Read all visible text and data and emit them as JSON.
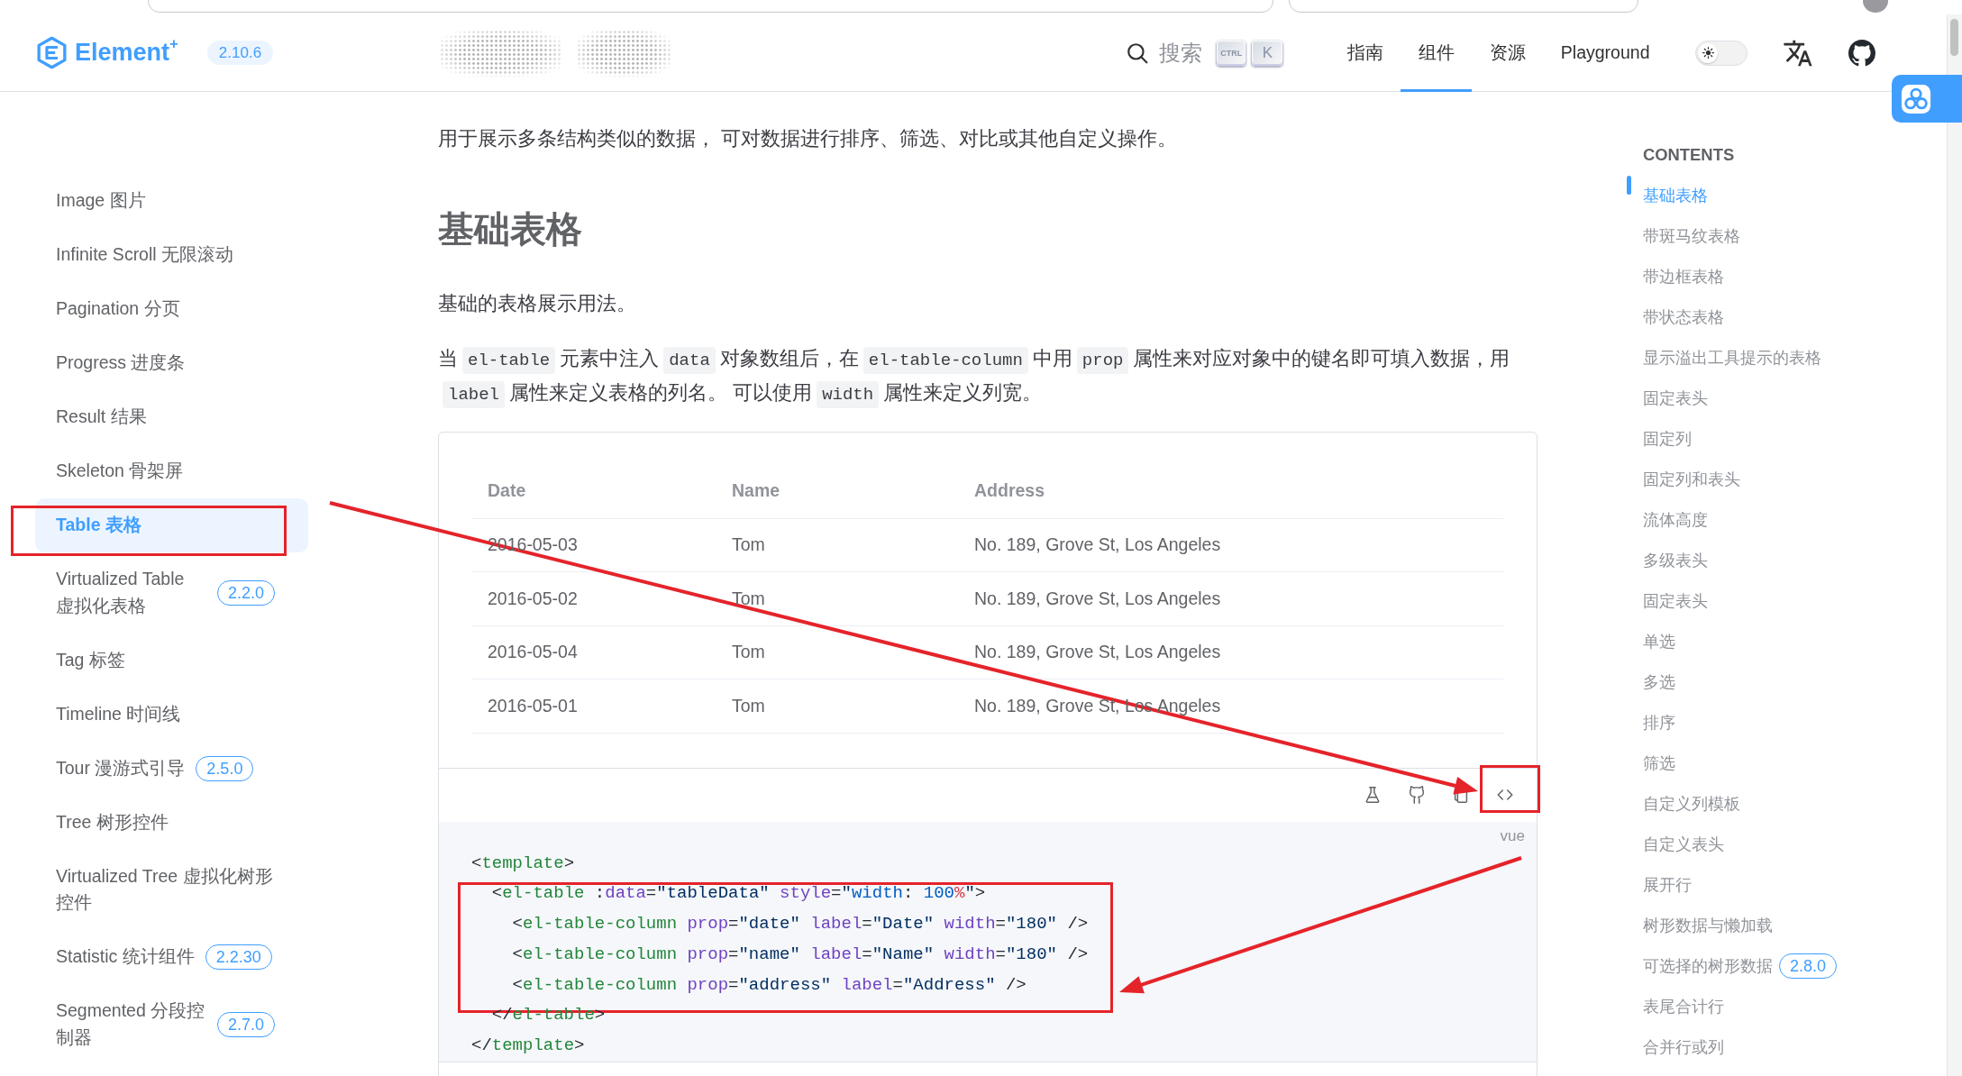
{
  "header": {
    "logo": "Element$^{+}$",
    "version": "2.10.6",
    "search": {
      "label": "搜索",
      "keys": [
        "CTRL",
        "K"
      ]
    },
    "nav": [
      {
        "label": "指南",
        "selected": false
      },
      {
        "label": "组件",
        "selected": true
      },
      {
        "label": "资源",
        "selected": false
      },
      {
        "label": "Playground",
        "selected": false
      }
    ],
    "dark_mode": false
  },
  "sidebar": {
    "items": [
      {
        "label": "Image 图片",
        "selected": false,
        "highlighted": false
      },
      {
        "label": "Infinite Scroll 无限滚动",
        "selected": false,
        "highlighted": false
      },
      {
        "label": "Pagination 分页",
        "selected": false,
        "highlighted": false
      },
      {
        "label": "Progress 进度条",
        "selected": false,
        "highlighted": false
      },
      {
        "label": "Result 结果",
        "selected": false,
        "highlighted": false
      },
      {
        "label": "Skeleton 骨架屏",
        "selected": false,
        "highlighted": false
      },
      {
        "label": "Table 表格",
        "selected": true,
        "highlighted": true
      },
      {
        "label": "Virtualized Table 虚拟化表格",
        "badge": "2.2.0",
        "selected": false,
        "highlighted": false
      },
      {
        "label": "Tag 标签",
        "selected": false,
        "highlighted": false
      },
      {
        "label": "Timeline 时间线",
        "selected": false,
        "highlighted": false
      },
      {
        "label": "Tour 漫游式引导",
        "badge": "2.5.0",
        "selected": false,
        "highlighted": false
      },
      {
        "label": "Tree 树形控件",
        "selected": false,
        "highlighted": false
      },
      {
        "label": "Virtualized Tree 虚拟化树形控件",
        "selected": false,
        "highlighted": false
      },
      {
        "label": "Statistic 统计组件",
        "badge": "2.2.30",
        "selected": false,
        "highlighted": false
      },
      {
        "label": "Segmented 分段控制器",
        "badge": "2.7.0",
        "selected": false,
        "highlighted": false
      }
    ]
  },
  "content": {
    "intro": "用于展示多条结构类似的数据， 可对数据进行排序、筛选、对比或其他自定义操作。",
    "heading": "基础表格",
    "lead": "基础的表格展示用法。",
    "description": [
      {
        "kind": "text",
        "text": "当"
      },
      {
        "kind": "code",
        "text": "el-table"
      },
      {
        "kind": "text",
        "text": "元素中注入"
      },
      {
        "kind": "code",
        "text": "data"
      },
      {
        "kind": "text",
        "text": "对象数组后，在"
      },
      {
        "kind": "code",
        "text": "el-table-column"
      },
      {
        "kind": "text",
        "text": "中用"
      },
      {
        "kind": "code",
        "text": "prop"
      },
      {
        "kind": "text",
        "text": "属性来对应对象中的键名即可填入数据，用"
      },
      {
        "kind": "code",
        "text": "label"
      },
      {
        "kind": "text",
        "text": "属性来定义表格的列名。 可以使用"
      },
      {
        "kind": "code",
        "text": "width"
      },
      {
        "kind": "text",
        "text": "属性来定义列宽。"
      }
    ]
  },
  "demo": {
    "table": {
      "columns": [
        "Date",
        "Name",
        "Address"
      ],
      "rows": [
        [
          "2016-05-03",
          "Tom",
          "No. 189, Grove St, Los Angeles"
        ],
        [
          "2016-05-02",
          "Tom",
          "No. 189, Grove St, Los Angeles"
        ],
        [
          "2016-05-04",
          "Tom",
          "No. 189, Grove St, Los Angeles"
        ],
        [
          "2016-05-01",
          "Tom",
          "No. 189, Grove St, Los Angeles"
        ]
      ]
    },
    "toolbar": [
      {
        "kind": "flask",
        "highlighted": false
      },
      {
        "kind": "github",
        "highlighted": false
      },
      {
        "kind": "copy",
        "highlighted": false
      },
      {
        "kind": "code",
        "highlighted": true
      }
    ],
    "code": {
      "language": "vue",
      "lines": [
        {
          "highlighted": false,
          "tokens": [
            {
              "kind": "punct",
              "text": "<"
            },
            {
              "kind": "tag",
              "text": "template"
            },
            {
              "kind": "punct",
              "text": ">"
            }
          ]
        },
        {
          "highlighted": true,
          "tokens": [
            {
              "kind": "punct",
              "text": "  <"
            },
            {
              "kind": "tag",
              "text": "el-table"
            },
            {
              "kind": "punct",
              "text": " :"
            },
            {
              "kind": "attr",
              "text": "data"
            },
            {
              "kind": "punct",
              "text": "="
            },
            {
              "kind": "string",
              "text": "\"tableData\""
            },
            {
              "kind": "attr",
              "text": " style"
            },
            {
              "kind": "punct",
              "text": "="
            },
            {
              "kind": "string",
              "text": "\""
            },
            {
              "kind": "prop",
              "text": "width"
            },
            {
              "kind": "punct",
              "text": ": "
            },
            {
              "kind": "number",
              "text": "100"
            },
            {
              "kind": "unit",
              "text": "%"
            },
            {
              "kind": "string",
              "text": "\""
            },
            {
              "kind": "punct",
              "text": ">"
            }
          ]
        },
        {
          "highlighted": true,
          "tokens": [
            {
              "kind": "punct",
              "text": "    <"
            },
            {
              "kind": "tag",
              "text": "el-table-column"
            },
            {
              "kind": "attr",
              "text": " prop"
            },
            {
              "kind": "punct",
              "text": "="
            },
            {
              "kind": "string",
              "text": "\"date\""
            },
            {
              "kind": "attr",
              "text": " label"
            },
            {
              "kind": "punct",
              "text": "="
            },
            {
              "kind": "string",
              "text": "\"Date\""
            },
            {
              "kind": "attr",
              "text": " width"
            },
            {
              "kind": "punct",
              "text": "="
            },
            {
              "kind": "string",
              "text": "\"180\""
            },
            {
              "kind": "punct",
              "text": " />"
            }
          ]
        },
        {
          "highlighted": true,
          "tokens": [
            {
              "kind": "punct",
              "text": "    <"
            },
            {
              "kind": "tag",
              "text": "el-table-column"
            },
            {
              "kind": "attr",
              "text": " prop"
            },
            {
              "kind": "punct",
              "text": "="
            },
            {
              "kind": "string",
              "text": "\"name\""
            },
            {
              "kind": "attr",
              "text": " label"
            },
            {
              "kind": "punct",
              "text": "="
            },
            {
              "kind": "string",
              "text": "\"Name\""
            },
            {
              "kind": "attr",
              "text": " width"
            },
            {
              "kind": "punct",
              "text": "="
            },
            {
              "kind": "string",
              "text": "\"180\""
            },
            {
              "kind": "punct",
              "text": " />"
            }
          ]
        },
        {
          "highlighted": true,
          "tokens": [
            {
              "kind": "punct",
              "text": "    <"
            },
            {
              "kind": "tag",
              "text": "el-table-column"
            },
            {
              "kind": "attr",
              "text": " prop"
            },
            {
              "kind": "punct",
              "text": "="
            },
            {
              "kind": "string",
              "text": "\"address\""
            },
            {
              "kind": "attr",
              "text": " label"
            },
            {
              "kind": "punct",
              "text": "="
            },
            {
              "kind": "string",
              "text": "\"Address\""
            },
            {
              "kind": "punct",
              "text": " />"
            }
          ]
        },
        {
          "highlighted": false,
          "tokens": [
            {
              "kind": "punct",
              "text": "  </"
            },
            {
              "kind": "tag",
              "text": "el-table"
            },
            {
              "kind": "punct",
              "text": ">"
            }
          ]
        },
        {
          "highlighted": false,
          "tokens": [
            {
              "kind": "punct",
              "text": "</"
            },
            {
              "kind": "tag",
              "text": "template"
            },
            {
              "kind": "punct",
              "text": ">"
            }
          ]
        }
      ]
    }
  },
  "toc": {
    "title": "CONTENTS",
    "items": [
      {
        "label": "基础表格",
        "selected": true
      },
      {
        "label": "带斑马纹表格",
        "selected": false
      },
      {
        "label": "带边框表格",
        "selected": false
      },
      {
        "label": "带状态表格",
        "selected": false
      },
      {
        "label": "显示溢出工具提示的表格",
        "selected": false
      },
      {
        "label": "固定表头",
        "selected": false
      },
      {
        "label": "固定列",
        "selected": false
      },
      {
        "label": "固定列和表头",
        "selected": false
      },
      {
        "label": "流体高度",
        "selected": false
      },
      {
        "label": "多级表头",
        "selected": false
      },
      {
        "label": "固定表头",
        "selected": false
      },
      {
        "label": "单选",
        "selected": false
      },
      {
        "label": "多选",
        "selected": false
      },
      {
        "label": "排序",
        "selected": false
      },
      {
        "label": "筛选",
        "selected": false
      },
      {
        "label": "自定义列模板",
        "selected": false
      },
      {
        "label": "自定义表头",
        "selected": false
      },
      {
        "label": "展开行",
        "selected": false
      },
      {
        "label": "树形数据与懒加载",
        "selected": false
      },
      {
        "label": "可选择的树形数据",
        "badge": "2.8.0",
        "selected": false
      },
      {
        "label": "表尾合计行",
        "selected": false
      },
      {
        "label": "合并行或列",
        "selected": false
      }
    ]
  }
}
